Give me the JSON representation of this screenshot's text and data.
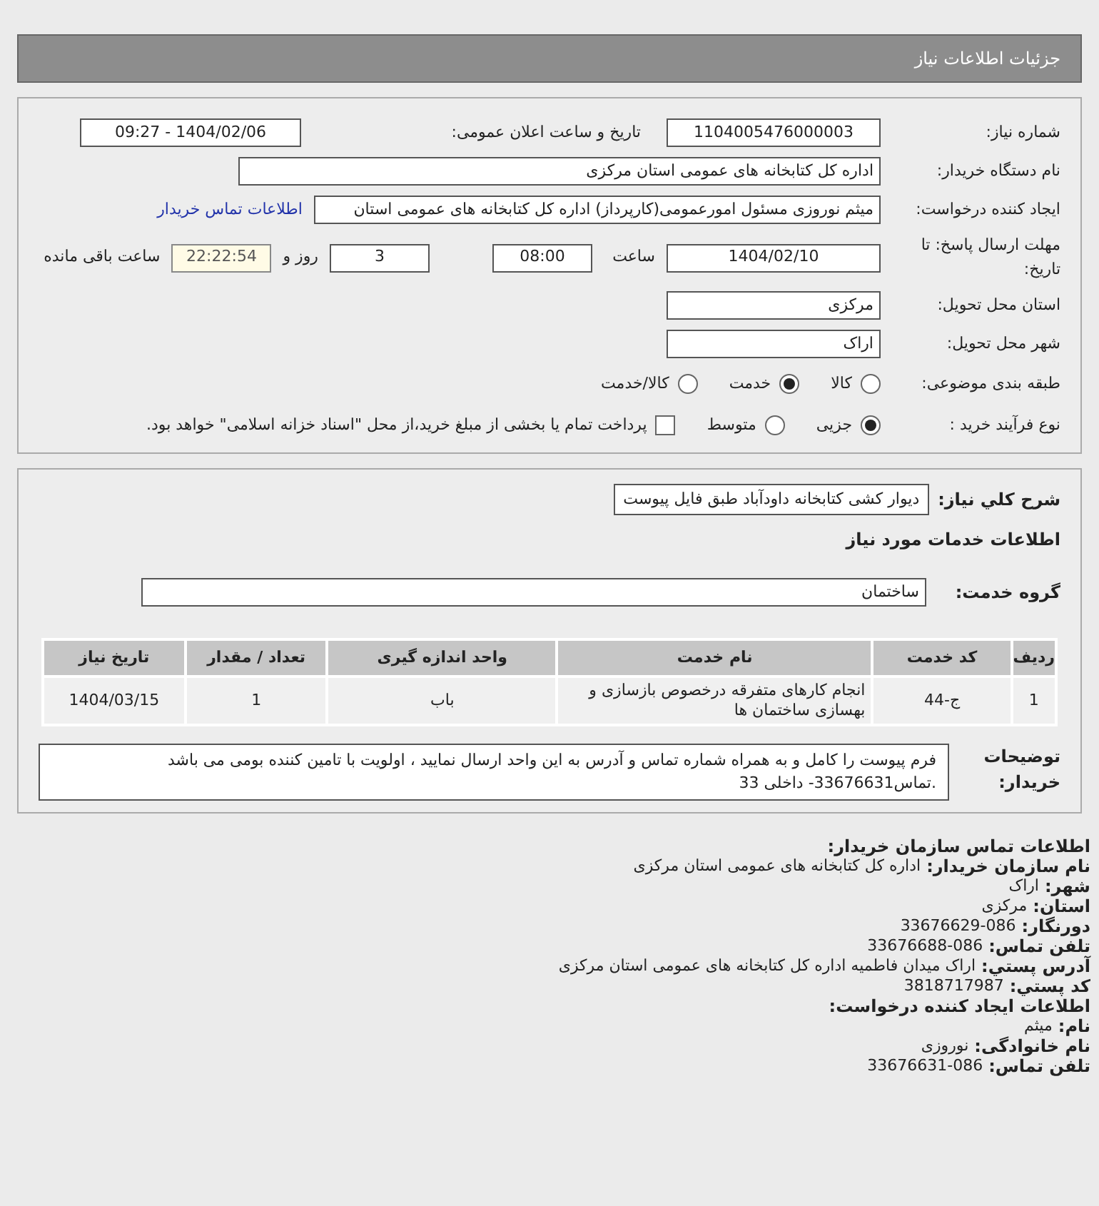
{
  "header": {
    "title": "جزئیات اطلاعات نیاز"
  },
  "need_number": {
    "label": "شماره نیاز:",
    "value": "1104005476000003"
  },
  "announce": {
    "label": "تاریخ و ساعت اعلان عمومی:",
    "value": "1404/02/06 - 09:27"
  },
  "buyer": {
    "label": "نام دستگاه خریدار:",
    "value": "اداره کل کتابخانه های عمومی استان مرکزی"
  },
  "requester": {
    "label": "ایجاد کننده درخواست:",
    "value": "میثم نوروزی مسئول امورعمومی(کارپرداز) اداره کل کتابخانه های عمومی استان",
    "link": "اطلاعات تماس خریدار"
  },
  "deadline": {
    "label": "مهلت ارسال پاسخ: تا تاریخ:",
    "date": "1404/02/10",
    "time_label": "ساعت",
    "time": "08:00",
    "days": "3",
    "days_label": "روز و",
    "remaining": "22:22:54",
    "remaining_label": "ساعت باقی مانده"
  },
  "province": {
    "label": "استان محل تحویل:",
    "value": "مرکزی"
  },
  "city": {
    "label": "شهر محل تحویل:",
    "value": "اراک"
  },
  "category": {
    "label": "طبقه بندی موضوعی:",
    "options": [
      {
        "label": "کالا",
        "selected": false
      },
      {
        "label": "خدمت",
        "selected": true
      },
      {
        "label": "کالا/خدمت",
        "selected": false
      }
    ]
  },
  "process": {
    "label": "نوع فرآیند خرید :",
    "options": [
      {
        "label": "جزیی",
        "selected": true
      },
      {
        "label": "متوسط",
        "selected": false
      }
    ],
    "payment": {
      "label": "پرداخت تمام یا بخشی از مبلغ خرید،از محل \"اسناد خزانه اسلامی\" خواهد بود.",
      "checked": false
    }
  },
  "description": {
    "label": "شرح کلي نياز:",
    "value": "دیوار کشی کتابخانه داودآباد طبق فایل پیوست"
  },
  "services_title": "اطلاعات خدمات مورد نیاز",
  "service_group": {
    "label": "گروه خدمت:",
    "value": "ساختمان"
  },
  "table": {
    "columns": [
      "ردیف",
      "کد خدمت",
      "نام خدمت",
      "واحد اندازه گیری",
      "تعداد / مقدار",
      "تاریخ نیاز"
    ],
    "rows": [
      [
        "1",
        "ج-44",
        "انجام کارهای متفرقه درخصوص بازسازی و بهسازی ساختمان ها",
        "باب",
        "1",
        "1404/03/15"
      ]
    ]
  },
  "notes": {
    "label": "توضیحات خریدار:",
    "value": "فرم پیوست را کامل و به همراه شماره تماس و آدرس به این واحد ارسال نمایید ، اولویت با تامین کننده بومی می باشد .تماس33676631- داخلی 33"
  },
  "contact": [
    {
      "kind": "heading",
      "text": "اطلاعات تماس سازمان خریدار:"
    },
    {
      "kind": "field",
      "label": "نام سازمان خریدار:",
      "value": "اداره کل کتابخانه های عمومی استان مرکزی"
    },
    {
      "kind": "field",
      "label": "شهر:",
      "value": "اراک"
    },
    {
      "kind": "field",
      "label": "استان:",
      "value": "مرکزی"
    },
    {
      "kind": "field",
      "label": "دورنگار:",
      "value": "33676629-086"
    },
    {
      "kind": "field",
      "label": "تلفن تماس:",
      "value": "33676688-086"
    },
    {
      "kind": "field",
      "label": "آدرس پستي:",
      "value": "اراک میدان فاطمیه اداره کل کتابخانه های عمومی استان مرکزی"
    },
    {
      "kind": "field",
      "label": "کد پستي:",
      "value": "3818717987"
    },
    {
      "kind": "heading",
      "text": "اطلاعات ایجاد کننده درخواست:"
    },
    {
      "kind": "field",
      "label": "نام:",
      "value": "میثم"
    },
    {
      "kind": "field",
      "label": "نام خانوادگی:",
      "value": "نوروزی"
    },
    {
      "kind": "field",
      "label": "تلفن تماس:",
      "value": "33676631-086"
    }
  ]
}
